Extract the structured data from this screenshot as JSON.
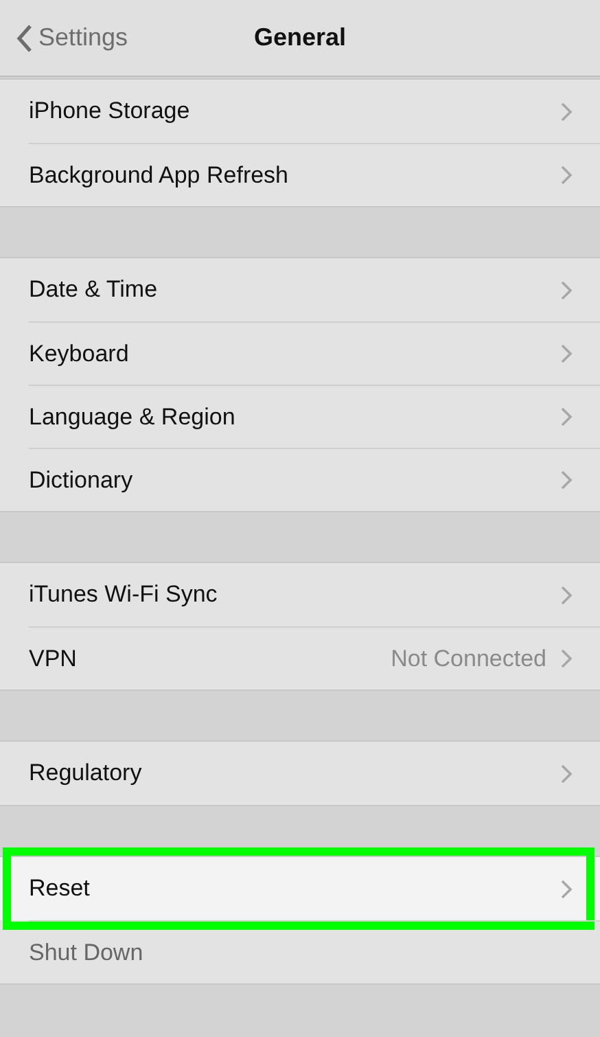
{
  "nav": {
    "back_label": "Settings",
    "title": "General"
  },
  "groups": [
    {
      "rows": [
        {
          "kind": "link",
          "label": "iPhone Storage",
          "highlighted": false
        },
        {
          "kind": "link",
          "label": "Background App Refresh",
          "highlighted": false
        }
      ]
    },
    {
      "rows": [
        {
          "kind": "link",
          "label": "Date & Time",
          "highlighted": false
        },
        {
          "kind": "link",
          "label": "Keyboard",
          "highlighted": false
        },
        {
          "kind": "link",
          "label": "Language & Region",
          "highlighted": false
        },
        {
          "kind": "link",
          "label": "Dictionary",
          "highlighted": false
        }
      ]
    },
    {
      "rows": [
        {
          "kind": "link",
          "label": "iTunes Wi-Fi Sync",
          "highlighted": false
        },
        {
          "kind": "link",
          "label": "VPN",
          "detail": "Not Connected",
          "highlighted": false
        }
      ]
    },
    {
      "rows": [
        {
          "kind": "link",
          "label": "Regulatory",
          "highlighted": false
        }
      ]
    },
    {
      "rows": [
        {
          "kind": "link",
          "label": "Reset",
          "highlighted": true
        },
        {
          "kind": "action",
          "label": "Shut Down",
          "highlighted": false
        }
      ]
    }
  ]
}
